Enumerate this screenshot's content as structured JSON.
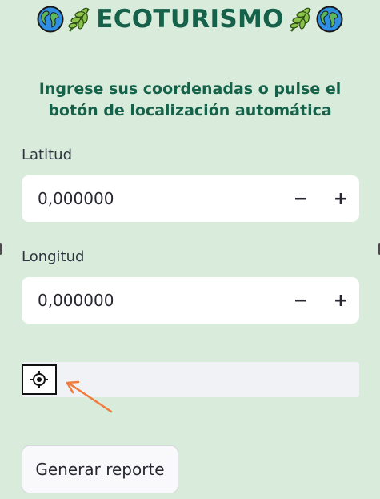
{
  "header": {
    "title": "ECOTURISMO"
  },
  "subtitle": "Ingrese sus coordenadas o pulse el botón de localización automática",
  "latitude": {
    "label": "Latitud",
    "value": "0,000000"
  },
  "longitude": {
    "label": "Longitud",
    "value": "0,000000"
  },
  "stepper": {
    "minus_symbol": "−",
    "plus_symbol": "+"
  },
  "locate": {
    "icon": "crosshair-icon"
  },
  "actions": {
    "report_label": "Generar reporte"
  },
  "colors": {
    "background": "#d9ecdc",
    "title_green": "#16614a",
    "arrow_orange": "#f07b3c"
  }
}
